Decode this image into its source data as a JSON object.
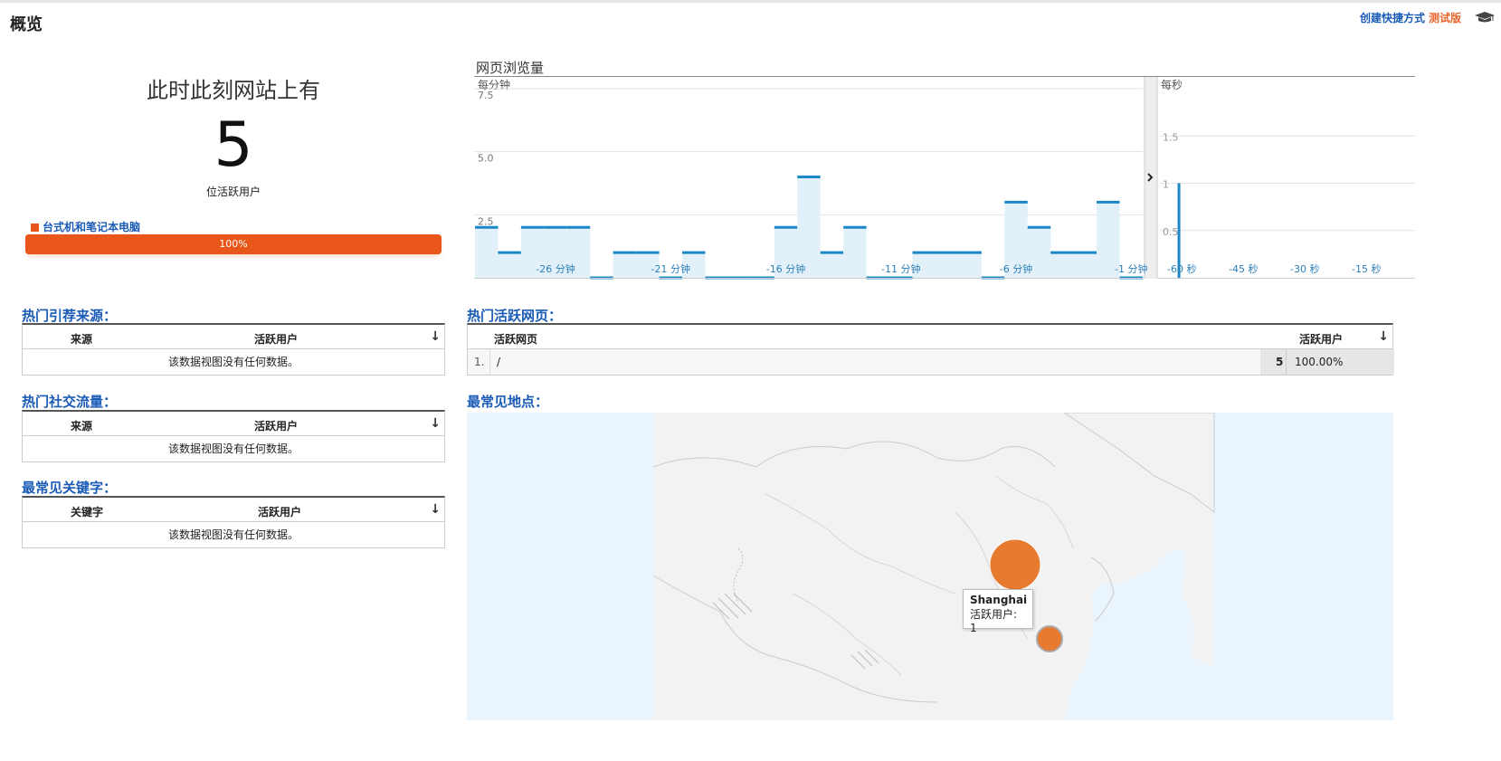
{
  "header": {
    "title": "概览",
    "create_shortcut": "创建快捷方式",
    "beta": "测试版",
    "education_icon": "graduation-cap-icon"
  },
  "active_users": {
    "title": "此时此刻网站上有",
    "count": "5",
    "unit": "位活跃用户",
    "device": {
      "label": "台式机和笔记本电脑",
      "percent_label": "100%",
      "share": 1.0,
      "color": "#e8561a"
    }
  },
  "pageviews": {
    "title": "网页浏览量",
    "per_minute_label": "每分钟",
    "per_second_label": "每秒",
    "collapse_icon": "chevron-right-icon"
  },
  "chart_data": [
    {
      "type": "bar",
      "title": "网页浏览量",
      "ylabel": "每分钟",
      "ylim": [
        0,
        7.5
      ],
      "yticks": [
        "7.5",
        "5.0",
        "2.5"
      ],
      "x_tick_labels": [
        "-26 分钟",
        "-21 分钟",
        "-16 分钟",
        "-11 分钟",
        "-6 分钟",
        "-1 分钟"
      ],
      "values": [
        2,
        1,
        2,
        2,
        2,
        0,
        1,
        1,
        0,
        1,
        0,
        0,
        0,
        2,
        4,
        1,
        2,
        0,
        0,
        1,
        1,
        1,
        0,
        3,
        2,
        1,
        1,
        3,
        0
      ],
      "grid": true
    },
    {
      "type": "bar",
      "title": "",
      "ylabel": "每秒",
      "ylim": [
        0,
        2
      ],
      "yticks": [
        "1.5",
        "1",
        "0.5"
      ],
      "x_tick_labels": [
        "-60 秒",
        "-45 秒",
        "-30 秒",
        "-15 秒"
      ],
      "points": [
        {
          "x": -58,
          "y": 1
        }
      ],
      "grid": true
    }
  ],
  "referrals": {
    "title": "热门引荐来源：",
    "col1": "来源",
    "col2": "活跃用户",
    "empty": "该数据视图没有任何数据。"
  },
  "social": {
    "title": "热门社交流量：",
    "col1": "来源",
    "col2": "活跃用户",
    "empty": "该数据视图没有任何数据。"
  },
  "keywords": {
    "title": "最常见关键字：",
    "col1": "关键字",
    "col2": "活跃用户",
    "empty": "该数据视图没有任何数据。"
  },
  "top_pages": {
    "title": "热门活跃网页：",
    "col1": "活跃网页",
    "col2": "活跃用户",
    "rows": [
      {
        "index": "1.",
        "page": "/",
        "users": "5",
        "percent": "100.00%"
      }
    ]
  },
  "locations": {
    "title": "最常见地点：",
    "tooltip_city": "Shanghai",
    "tooltip_value": "活跃用户: 1"
  }
}
